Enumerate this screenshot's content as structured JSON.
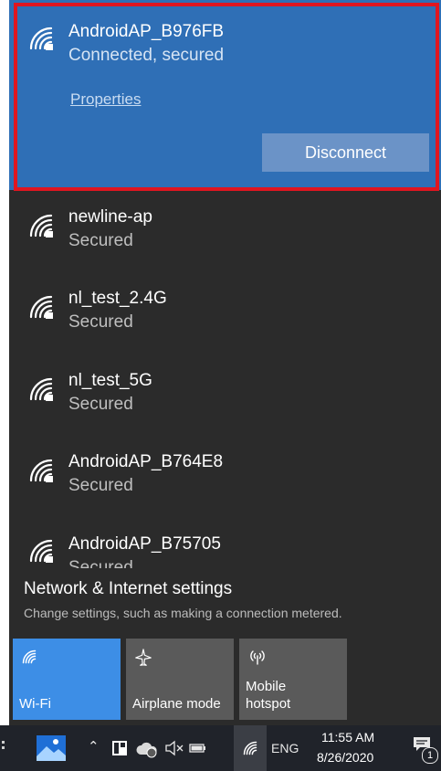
{
  "connected_network": {
    "name": "AndroidAP_B976FB",
    "status": "Connected, secured",
    "properties_label": "Properties",
    "disconnect_label": "Disconnect"
  },
  "networks": [
    {
      "name": "newline-ap",
      "status": "Secured"
    },
    {
      "name": "nl_test_2.4G",
      "status": "Secured"
    },
    {
      "name": "nl_test_5G",
      "status": "Secured"
    },
    {
      "name": "AndroidAP_B764E8",
      "status": "Secured"
    },
    {
      "name": "AndroidAP_B75705",
      "status": "Secured"
    }
  ],
  "settings": {
    "link_label": "Network & Internet settings",
    "description": "Change settings, such as making a connection metered."
  },
  "quick_actions": [
    {
      "label": "Wi-Fi",
      "active": true,
      "icon": "wifi-icon"
    },
    {
      "label": "Airplane mode",
      "active": false,
      "icon": "airplane-icon"
    },
    {
      "label": "Mobile\nhotspot",
      "active": false,
      "icon": "hotspot-icon"
    }
  ],
  "taskbar": {
    "language": "ENG",
    "time": "11:55 AM",
    "date": "8/26/2020",
    "notification_count": "1"
  },
  "colors": {
    "accent": "#2f6fb6",
    "flyout_bg": "#2b2b2b",
    "highlight_border": "#e01620",
    "active_tile": "#3d8ee6"
  }
}
